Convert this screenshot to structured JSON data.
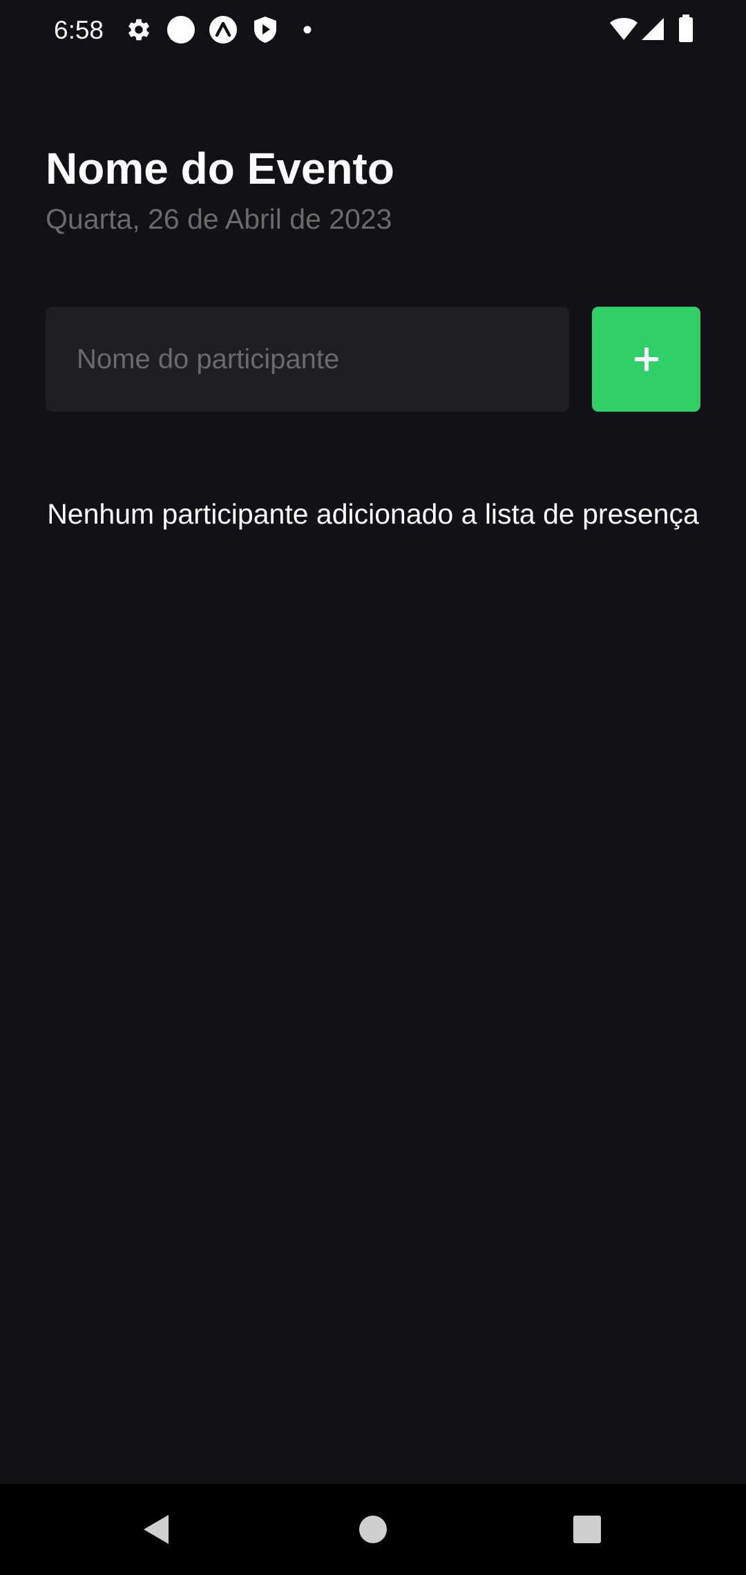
{
  "status_bar": {
    "time": "6:58",
    "left_icons": [
      "gear-icon",
      "circle-icon",
      "expo-icon",
      "play-shield-icon",
      "dot-icon"
    ],
    "right_icons": [
      "wifi-icon",
      "signal-icon",
      "battery-icon"
    ]
  },
  "header": {
    "title": "Nome do Evento",
    "date": "Quarta, 26 de Abril de 2023"
  },
  "form": {
    "input_value": "",
    "input_placeholder": "Nome do participante",
    "add_button_label": "+"
  },
  "empty_message": "Nenhum participante adicionado a lista de presença",
  "nav_bar": {
    "icons": [
      "back-icon",
      "home-icon",
      "recents-icon"
    ]
  },
  "colors": {
    "background": "#131016",
    "input_background": "#1f1e25",
    "accent": "#31cf67",
    "muted_text": "#6b6b6b",
    "text": "#fdfcfe"
  }
}
